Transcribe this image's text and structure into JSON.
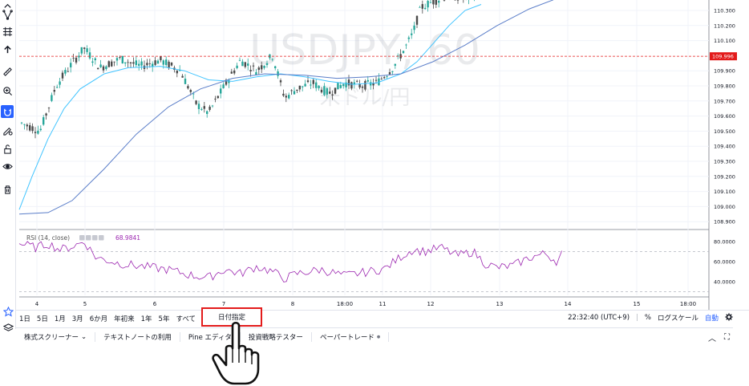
{
  "chart": {
    "symbol_watermark": "USDJPY, 60",
    "symbol_watermark_sub": "米ドル/円",
    "price_ticks": [
      "110.300",
      "110.200",
      "110.100",
      "109.996",
      "109.900",
      "109.800",
      "109.700",
      "109.600",
      "109.500",
      "109.400",
      "109.300",
      "109.200",
      "109.100",
      "109.000",
      "108.900"
    ],
    "current_price_label": "109.996",
    "rsi_label": "RSI (14, close)",
    "rsi_value": "68.9841",
    "rsi_ticks": [
      "80.0000",
      "60.0000",
      "40.0000"
    ],
    "x_labels": [
      "4",
      "5",
      "6",
      "7",
      "8",
      "18:00",
      "11",
      "12",
      "13",
      "14",
      "15",
      "18:00"
    ],
    "colors": {
      "up": "#26a69a",
      "down": "#4a4a4a",
      "price_line": "#e31b1b",
      "fast_ma": "#40c4ff",
      "slow_ma": "#5b7ec9",
      "rsi": "#9c27b0"
    }
  },
  "range_bar": {
    "buttons": [
      "1日",
      "5日",
      "1月",
      "3月",
      "6か月",
      "年初来",
      "1年",
      "5年",
      "すべて"
    ],
    "date_range": "日付指定",
    "time": "22:32:40 (UTC+9)",
    "percent": "%",
    "log_scale": "ログスケール",
    "auto": "自動"
  },
  "bottom_tabs": {
    "tabs": [
      "株式スクリーナー",
      "テキストノートの利用",
      "Pine エディタ",
      "投資戦略テスター",
      "ペーパートレード"
    ],
    "screener_caret": "⌄",
    "paper_trade_dot": "●",
    "collapse": "︿",
    "expand": "⛶"
  }
}
